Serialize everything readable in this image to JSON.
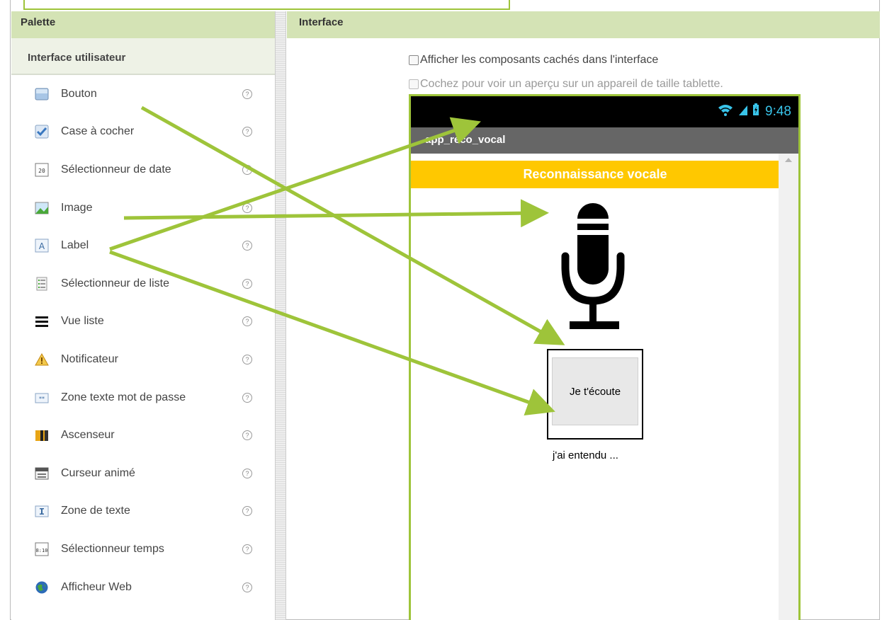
{
  "palette": {
    "header": "Palette",
    "category": "Interface utilisateur",
    "items": [
      {
        "label": "Bouton",
        "icon": "button-icon"
      },
      {
        "label": "Case à cocher",
        "icon": "checkbox-icon"
      },
      {
        "label": "Sélectionneur de date",
        "icon": "date-picker-icon"
      },
      {
        "label": "Image",
        "icon": "image-icon"
      },
      {
        "label": "Label",
        "icon": "label-icon"
      },
      {
        "label": "Sélectionneur de liste",
        "icon": "list-picker-icon"
      },
      {
        "label": "Vue liste",
        "icon": "list-view-icon"
      },
      {
        "label": "Notificateur",
        "icon": "notifier-icon"
      },
      {
        "label": "Zone texte mot de passe",
        "icon": "password-textbox-icon"
      },
      {
        "label": "Ascenseur",
        "icon": "slider-icon"
      },
      {
        "label": "Curseur animé",
        "icon": "spinner-icon"
      },
      {
        "label": "Zone de texte",
        "icon": "textbox-icon"
      },
      {
        "label": "Sélectionneur temps",
        "icon": "time-picker-icon"
      },
      {
        "label": "Afficheur Web",
        "icon": "web-viewer-icon"
      }
    ],
    "help_glyph": "?"
  },
  "interface": {
    "header": "Interface",
    "show_hidden_label": "Afficher les composants cachés dans l'interface",
    "tablet_preview_label": "Cochez pour voir un aperçu sur un appareil de taille tablette."
  },
  "phone": {
    "time": "9:48",
    "app_title": "app_reco_vocal",
    "banner": "Reconnaissance vocale",
    "button_text": "Je t'écoute",
    "result_label": "j'ai entendu ..."
  },
  "colors": {
    "accent_green": "#9ec43a",
    "header_green": "#d4e3b5",
    "banner_yellow": "#ffc800",
    "status_blue": "#39c4ea"
  }
}
